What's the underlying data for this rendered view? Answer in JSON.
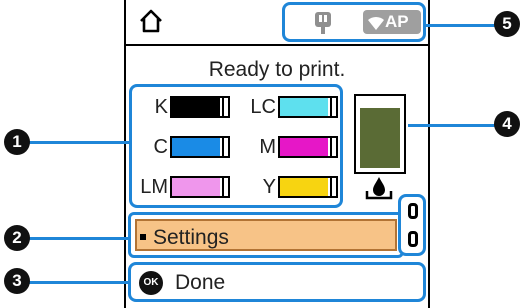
{
  "status": {
    "message": "Ready to print."
  },
  "topbar": {
    "wifi_label": "AP"
  },
  "inks": [
    {
      "code": "K",
      "color": "#000000",
      "level": 0.85
    },
    {
      "code": "LC",
      "color": "#5ee0ee",
      "level": 0.85
    },
    {
      "code": "C",
      "color": "#1a8be6",
      "level": 0.85
    },
    {
      "code": "M",
      "color": "#e617c7",
      "level": 0.85
    },
    {
      "code": "LM",
      "color": "#ef96ec",
      "level": 0.85
    },
    {
      "code": "Y",
      "color": "#f7d411",
      "level": 0.85
    }
  ],
  "maintenance_box": {
    "color": "#5a6b35",
    "level": 0.9
  },
  "menu": {
    "selected_item": "Settings"
  },
  "footer": {
    "ok_glyph": "OK",
    "done_label": "Done"
  },
  "callouts": [
    "1",
    "2",
    "3",
    "4",
    "5"
  ],
  "colors": {
    "highlight": "#1f86d8",
    "selection": "#f7c387"
  }
}
